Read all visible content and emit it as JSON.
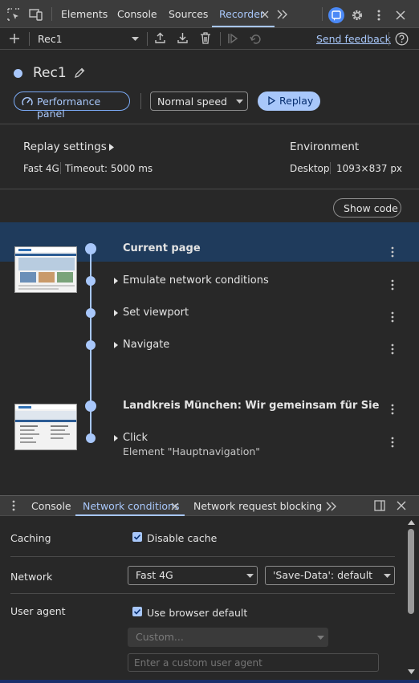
{
  "topbar": {
    "tabs": [
      "Elements",
      "Console",
      "Sources",
      "Recorder"
    ],
    "active_tab": "Recorder"
  },
  "toolbar": {
    "recording_select": "Rec1",
    "send_feedback": "Send feedback"
  },
  "recording": {
    "title": "Rec1",
    "performance_panel_label": "Performance panel",
    "speed_select": "Normal speed",
    "replay_label": "Replay"
  },
  "settings": {
    "replay_settings_label": "Replay settings",
    "network": "Fast 4G",
    "timeout": "Timeout: 5000 ms",
    "environment_label": "Environment",
    "device": "Desktop",
    "viewport": "1093×837 px"
  },
  "show_code_label": "Show code",
  "steps": [
    {
      "title": "Current page",
      "bold": true,
      "expandable": false
    },
    {
      "title": "Emulate network conditions",
      "bold": false,
      "expandable": true
    },
    {
      "title": "Set viewport",
      "bold": false,
      "expandable": true
    },
    {
      "title": "Navigate",
      "bold": false,
      "expandable": true
    },
    {
      "title": "Landkreis München: Wir gemeinsam für Sie",
      "bold": true,
      "expandable": false
    },
    {
      "title": "Click",
      "subtitle": "Element \"Hauptnavigation\"",
      "bold": false,
      "expandable": true
    }
  ],
  "drawer": {
    "tabs": [
      "Console",
      "Network conditions",
      "Network request blocking"
    ],
    "active_tab": "Network conditions",
    "caching_label": "Caching",
    "disable_cache_label": "Disable cache",
    "disable_cache_checked": true,
    "network_label": "Network",
    "network_select": "Fast 4G",
    "save_data_select": "'Save-Data': default",
    "user_agent_label": "User agent",
    "use_default_label": "Use browser default",
    "use_default_checked": true,
    "custom_select": "Custom...",
    "custom_ua_placeholder": "Enter a custom user agent"
  },
  "colors": {
    "accent": "#a8c7fa",
    "selected_row": "#1f3b5c",
    "background": "#282828",
    "toolbar": "#3c3c3c"
  }
}
